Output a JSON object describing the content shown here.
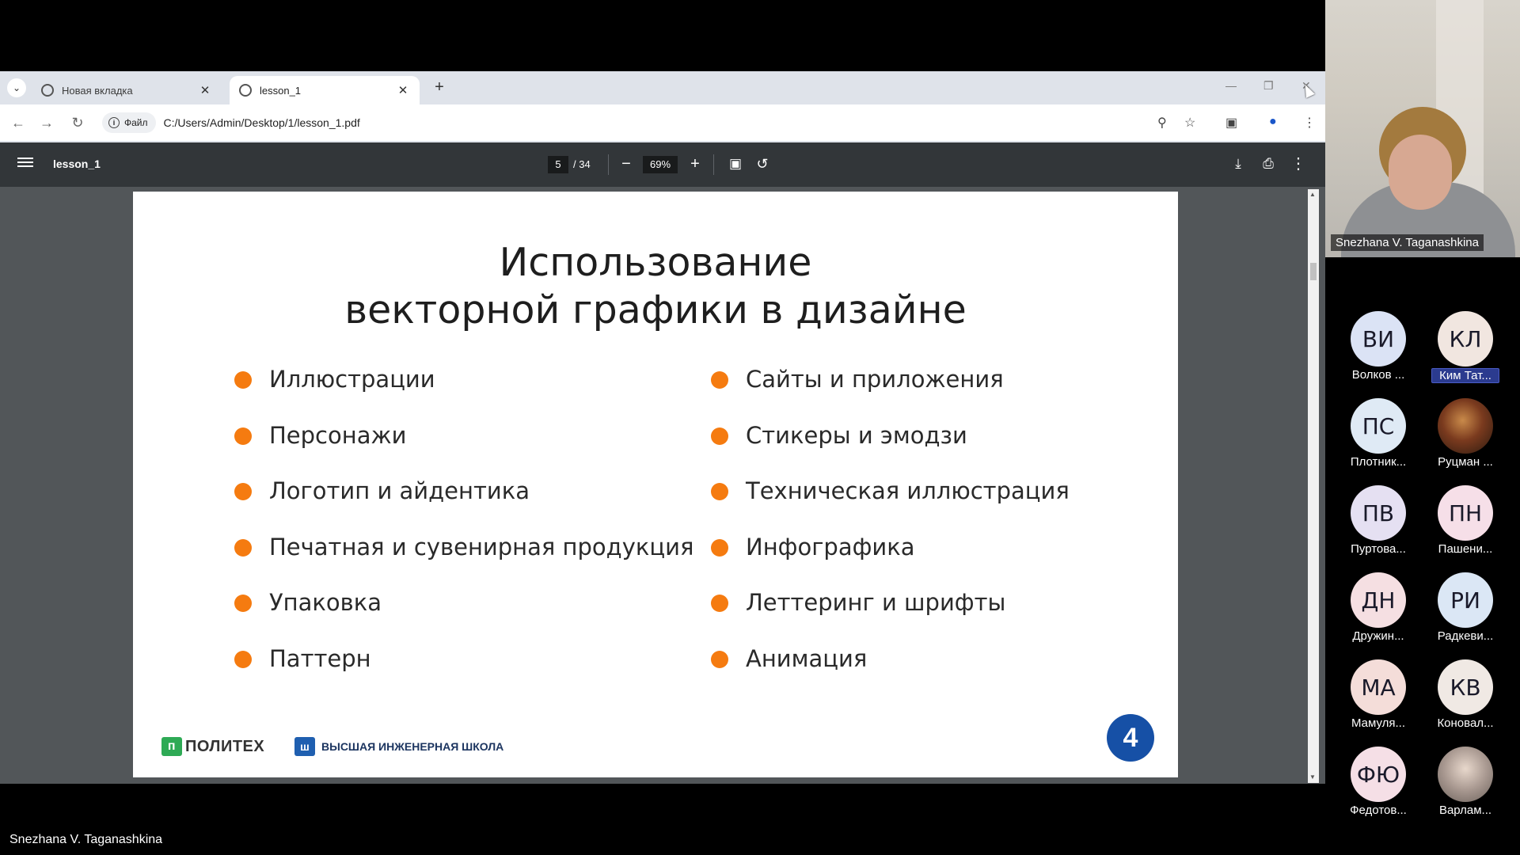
{
  "browser": {
    "tabs": [
      {
        "label": "Новая вкладка",
        "active": false
      },
      {
        "label": "lesson_1",
        "active": true
      }
    ],
    "site_chip": "Файл",
    "url": "C:/Users/Admin/Desktop/1/lesson_1.pdf"
  },
  "pdf": {
    "title": "lesson_1",
    "current_page": "5",
    "total_pages": "/ 34",
    "zoom": "69%"
  },
  "slide": {
    "title_line1": "Использование",
    "title_line2": "векторной графики в дизайне",
    "left_items": [
      "Иллюстрации",
      "Персонажи",
      "Логотип и айдентика",
      "Печатная и сувенирная продукция",
      "Упаковка",
      "Паттерн"
    ],
    "right_items": [
      "Сайты и приложения",
      "Стикеры и эмодзи",
      "Техническая иллюстрация",
      "Инфографика",
      "Леттеринг и шрифты",
      "Анимация"
    ],
    "logo_politeh": "ПОЛИТЕХ",
    "logo_vish": "ВЫСШАЯ ИНЖЕНЕРНАЯ ШКОЛА",
    "page_number": "4",
    "accent_color": "#f57b10"
  },
  "meeting": {
    "speaker_name": "Snezhana V. Taganashkina",
    "participants": [
      {
        "initials": "ВИ",
        "name": "Волков ...",
        "color": "#dbe3f5"
      },
      {
        "initials": "КЛ",
        "name": "Ким Тат...",
        "color": "#f1e6e0",
        "active": true
      },
      {
        "initials": "ПС",
        "name": "Плотник...",
        "color": "#dfeaf5"
      },
      {
        "initials": "",
        "name": "Руцман ...",
        "color": "#6b3b22",
        "photo": true
      },
      {
        "initials": "ПВ",
        "name": "Пуртова...",
        "color": "#e5e0f2"
      },
      {
        "initials": "ПН",
        "name": "Пашени...",
        "color": "#f6dfe8"
      },
      {
        "initials": "ДН",
        "name": "Дружин...",
        "color": "#f5dfe2"
      },
      {
        "initials": "РИ",
        "name": "Радкеви...",
        "color": "#dbe7f5"
      },
      {
        "initials": "МА",
        "name": "Мамуля...",
        "color": "#f4ddd9"
      },
      {
        "initials": "КВ",
        "name": "Коновал...",
        "color": "#f0e9e4"
      },
      {
        "initials": "ФЮ",
        "name": "Федотов...",
        "color": "#f5dfe6"
      },
      {
        "initials": "",
        "name": "Варлам...",
        "color": "#b5aaa4",
        "photo": true
      }
    ],
    "footer_name": "Snezhana V. Taganashkina"
  }
}
